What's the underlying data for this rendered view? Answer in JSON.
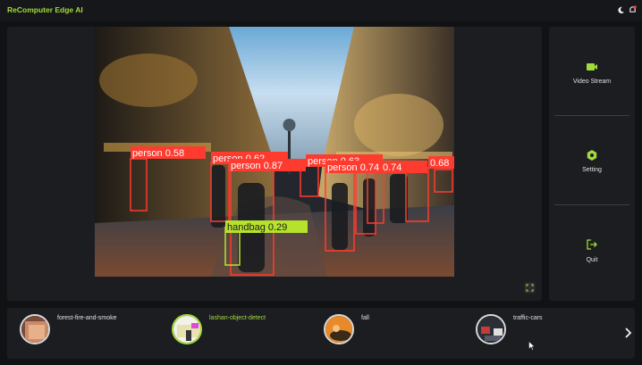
{
  "app": {
    "title": "ReComputer Edge AI"
  },
  "header_icons": [
    "moon-icon",
    "notification-icon"
  ],
  "colors": {
    "accent": "#a4d93c",
    "person_box": "#ff3b30",
    "handbag_box": "#b6e22e"
  },
  "detections": [
    {
      "label": "person",
      "score": "0.58"
    },
    {
      "label": "person",
      "score": "0.62"
    },
    {
      "label": "person",
      "score": "0.87"
    },
    {
      "label": "person",
      "score": "0.63"
    },
    {
      "label": "person",
      "score": "0.74"
    },
    {
      "label": "person",
      "score": "0.74"
    },
    {
      "label": "person",
      "score": "0.68"
    },
    {
      "label": "handbag",
      "score": "0.29"
    }
  ],
  "side_menu": {
    "items": [
      {
        "label": "Video Stream",
        "icon": "video-camera-icon"
      },
      {
        "label": "Setting",
        "icon": "gear-icon"
      },
      {
        "label": "Quit",
        "icon": "exit-icon"
      }
    ]
  },
  "models": [
    {
      "label": "forest-fire-and-smoke",
      "active": false
    },
    {
      "label": "lashan-object-detect",
      "active": true
    },
    {
      "label": "fall",
      "active": false
    },
    {
      "label": "traffic-cars",
      "active": false
    }
  ]
}
